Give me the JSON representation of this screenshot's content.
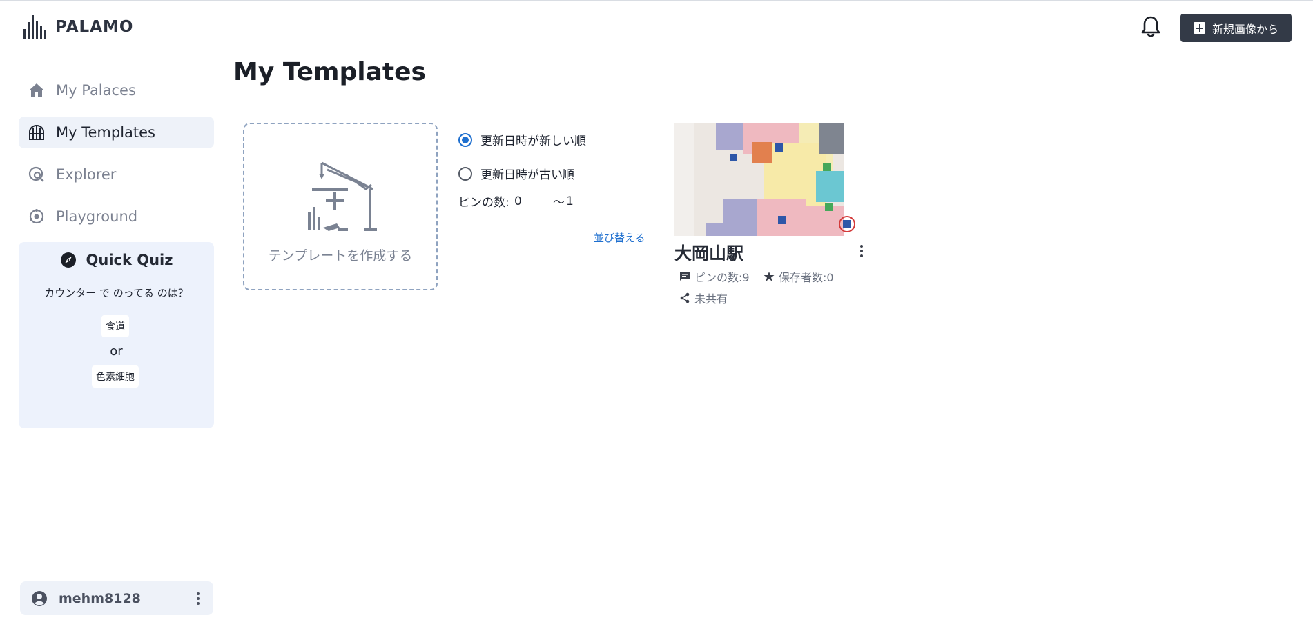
{
  "header": {
    "logo_text": "PALAMO",
    "notification_icon": "bell-icon",
    "new_button_label": "新規画像から"
  },
  "sidebar": {
    "items": [
      {
        "label": "My Palaces",
        "icon": "home-icon",
        "active": false
      },
      {
        "label": "My Templates",
        "icon": "template-icon",
        "active": true
      },
      {
        "label": "Explorer",
        "icon": "explore-icon",
        "active": false
      },
      {
        "label": "Playground",
        "icon": "playground-icon",
        "active": false
      }
    ],
    "quiz": {
      "title": "Quick Quiz",
      "question": "カウンター で のってる のは？",
      "option_a": "食道",
      "or_text": "or",
      "option_b": "色素細胞"
    },
    "user": {
      "name": "mehm8128"
    }
  },
  "main": {
    "title": "My Templates",
    "create_card_label": "テンプレートを作成する",
    "sort": {
      "options": [
        "更新日時が新しい順",
        "更新日時が古い順"
      ],
      "selected_index": 0,
      "pin_label": "ピンの数:",
      "pin_min": "0",
      "pin_separator": "〜",
      "pin_max": "1",
      "sort_button": "並び替える"
    },
    "templates": [
      {
        "name": "大岡山駅",
        "pins": "ピンの数:9",
        "savers": "保存者数:0",
        "share_status": "未共有"
      }
    ]
  },
  "colors": {
    "accent": "#1e6fcf",
    "button_dark": "#333a47",
    "sidebar_active": "#eef2f9",
    "quiz_bg": "#edf2fc"
  }
}
